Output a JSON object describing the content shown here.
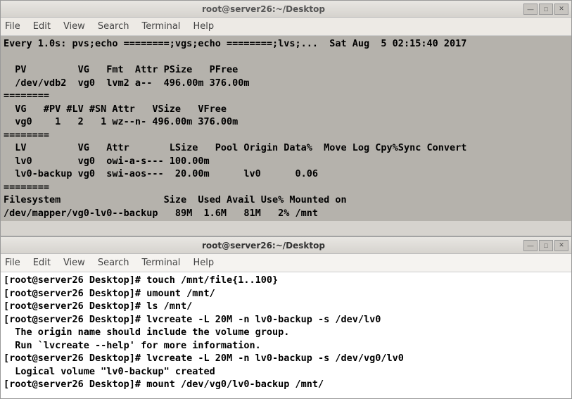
{
  "window1": {
    "title": "root@server26:~/Desktop",
    "menu": [
      "File",
      "Edit",
      "View",
      "Search",
      "Terminal",
      "Help"
    ],
    "content": "Every 1.0s: pvs;echo ========;vgs;echo ========;lvs;...  Sat Aug  5 02:15:40 2017\n\n  PV         VG   Fmt  Attr PSize   PFree\n  /dev/vdb2  vg0  lvm2 a--  496.00m 376.00m\n========\n  VG   #PV #LV #SN Attr   VSize   VFree\n  vg0    1   2   1 wz--n- 496.00m 376.00m\n========\n  LV         VG   Attr       LSize   Pool Origin Data%  Move Log Cpy%Sync Convert\n  lv0        vg0  owi-a-s--- 100.00m\n  lv0-backup vg0  swi-aos---  20.00m      lv0      0.06\n========\nFilesystem                  Size  Used Avail Use% Mounted on\n/dev/mapper/vg0-lv0--backup   89M  1.6M   81M   2% /mnt"
  },
  "window2": {
    "title": "root@server26:~/Desktop",
    "menu": [
      "File",
      "Edit",
      "View",
      "Search",
      "Terminal",
      "Help"
    ],
    "content": "[root@server26 Desktop]# touch /mnt/file{1..100}\n[root@server26 Desktop]# umount /mnt/\n[root@server26 Desktop]# ls /mnt/\n[root@server26 Desktop]# lvcreate -L 20M -n lv0-backup -s /dev/lv0\n  The origin name should include the volume group.\n  Run `lvcreate --help' for more information.\n[root@server26 Desktop]# lvcreate -L 20M -n lv0-backup -s /dev/vg0/lv0\n  Logical volume \"lv0-backup\" created\n[root@server26 Desktop]# mount /dev/vg0/lv0-backup /mnt/"
  },
  "chart_data": {
    "type": "table",
    "tables": [
      {
        "name": "pvs",
        "columns": [
          "PV",
          "VG",
          "Fmt",
          "Attr",
          "PSize",
          "PFree"
        ],
        "rows": [
          [
            "/dev/vdb2",
            "vg0",
            "lvm2",
            "a--",
            "496.00m",
            "376.00m"
          ]
        ]
      },
      {
        "name": "vgs",
        "columns": [
          "VG",
          "#PV",
          "#LV",
          "#SN",
          "Attr",
          "VSize",
          "VFree"
        ],
        "rows": [
          [
            "vg0",
            "1",
            "2",
            "1",
            "wz--n-",
            "496.00m",
            "376.00m"
          ]
        ]
      },
      {
        "name": "lvs",
        "columns": [
          "LV",
          "VG",
          "Attr",
          "LSize",
          "Pool",
          "Origin",
          "Data%",
          "Move",
          "Log",
          "Cpy%Sync",
          "Convert"
        ],
        "rows": [
          [
            "lv0",
            "vg0",
            "owi-a-s---",
            "100.00m",
            "",
            "",
            "",
            "",
            "",
            "",
            ""
          ],
          [
            "lv0-backup",
            "vg0",
            "swi-aos---",
            "20.00m",
            "",
            "lv0",
            "0.06",
            "",
            "",
            "",
            ""
          ]
        ]
      },
      {
        "name": "df",
        "columns": [
          "Filesystem",
          "Size",
          "Used",
          "Avail",
          "Use%",
          "Mounted on"
        ],
        "rows": [
          [
            "/dev/mapper/vg0-lv0--backup",
            "89M",
            "1.6M",
            "81M",
            "2%",
            "/mnt"
          ]
        ]
      }
    ]
  }
}
